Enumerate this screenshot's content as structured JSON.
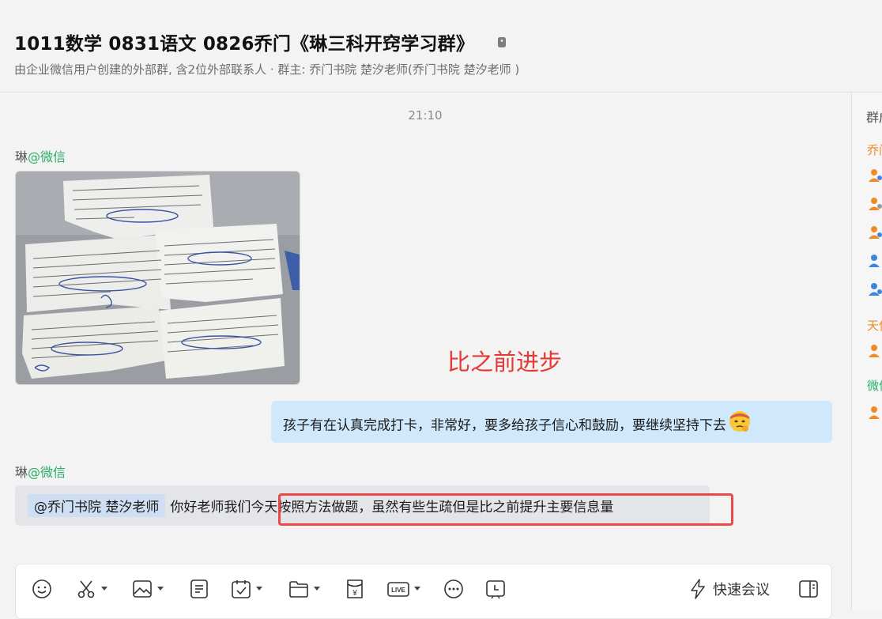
{
  "header": {
    "title": "1011数学 0831语文 0826乔门《琳三科开窍学习群》",
    "subtitle": "由企业微信用户创建的外部群, 含2位外部联系人 · 群主: 乔门书院 楚汐老师(乔门书院 楚汐老师 )"
  },
  "chat": {
    "time": "21:10",
    "msg1": {
      "sender": "琳",
      "source": "@微信"
    },
    "annotation": "比之前进步",
    "my_message": "孩子有在认真完成打卡，非常好，要多给孩子信心和鼓励，要继续坚持下去",
    "msg2": {
      "sender": "琳",
      "source": "@微信",
      "mention": "@乔门书院 楚汐老师",
      "text": "你好老师我们今天按照方法做题，虽然有些生疏但是比之前提升主要信息量"
    }
  },
  "right_panel": {
    "title": "群成员",
    "sec1": "乔门书院",
    "sec2": "天使",
    "sec3": "微信"
  },
  "composer": {
    "quick_meeting": "快速会议"
  },
  "colors": {
    "accent_green": "#2aae67",
    "bubble_me": "#cfe8fc",
    "bubble_in": "#e4e5e8",
    "highlight_red": "#e84a4a",
    "orange_member": "#f08a24",
    "blue_member": "#3b87e0"
  },
  "icons": [
    "lock-icon",
    "emoji-icon",
    "scissors-icon",
    "image-icon",
    "document-icon",
    "calendar-icon",
    "folder-icon",
    "redpacket-icon",
    "live-icon",
    "more-icon",
    "schedule-icon",
    "lightning-icon",
    "panel-toggle-icon"
  ]
}
